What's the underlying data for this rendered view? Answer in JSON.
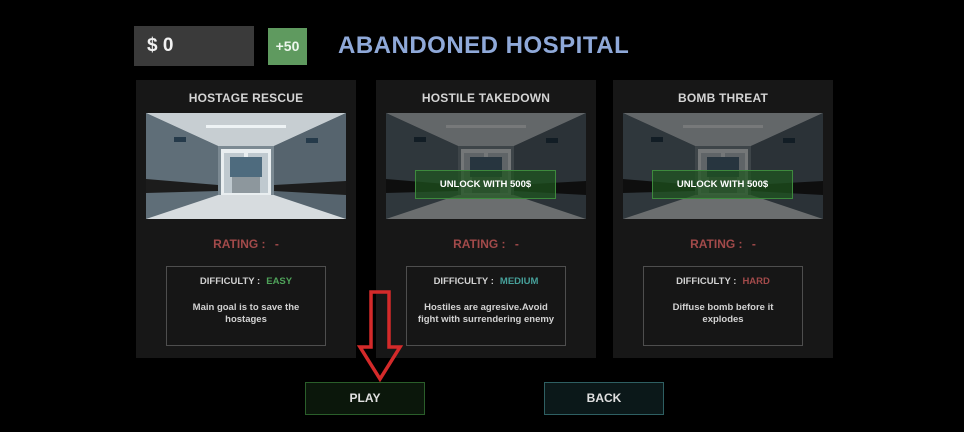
{
  "header": {
    "money": "$ 0",
    "add_money_label": "+50",
    "title": "ABANDONED HOSPITAL"
  },
  "missions": [
    {
      "title": "HOSTAGE RESCUE",
      "locked": false,
      "rating_label": "RATING :",
      "rating_value": "-",
      "difficulty_label": "DIFFICULTY :",
      "difficulty_value": "EASY",
      "description": "Main goal is to save the hostages"
    },
    {
      "title": "HOSTILE TAKEDOWN",
      "locked": true,
      "unlock_label": "UNLOCK WITH 500$",
      "rating_label": "RATING :",
      "rating_value": "-",
      "difficulty_label": "DIFFICULTY :",
      "difficulty_value": "MEDIUM",
      "description": "Hostiles are agresive.Avoid fight with surrendering enemy"
    },
    {
      "title": "BOMB THREAT",
      "locked": true,
      "unlock_label": "UNLOCK WITH 500$",
      "rating_label": "RATING :",
      "rating_value": "-",
      "difficulty_label": "DIFFICULTY :",
      "difficulty_value": "HARD",
      "description": "Diffuse bomb before it explodes"
    }
  ],
  "footer": {
    "play_label": "PLAY",
    "back_label": "BACK"
  },
  "colors": {
    "title": "#8fa9d9",
    "plus_button": "#5f9a5f",
    "rating": "#a24a4a",
    "difficulty_easy": "#4fa35a",
    "difficulty_medium": "#46a09a",
    "difficulty_hard": "#a24a4a",
    "unlock_border": "#3d8a3d",
    "arrow": "#d42a2a"
  },
  "icons": {
    "hint_arrow": "down-arrow-icon"
  }
}
